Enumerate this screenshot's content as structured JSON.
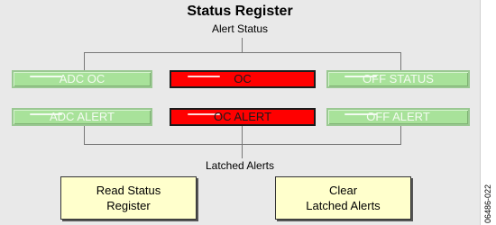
{
  "panel": {
    "title": "Status Register",
    "alert_status_label": "Alert Status",
    "latched_alerts_label": "Latched Alerts"
  },
  "indicators": {
    "adc_oc": {
      "label": "ADC OC",
      "state": "off"
    },
    "oc": {
      "label": "OC",
      "state": "on"
    },
    "off_status": {
      "label": "OFF STATUS",
      "state": "off"
    },
    "adc_alert": {
      "label": "ADC ALERT",
      "state": "off"
    },
    "oc_alert": {
      "label": "OC ALERT",
      "state": "on"
    },
    "off_alert": {
      "label": "OFF ALERT",
      "state": "off"
    }
  },
  "buttons": {
    "read_status": {
      "line1": "Read Status",
      "line2": "Register"
    },
    "clear_latched": {
      "line1": "Clear",
      "line2": "Latched Alerts"
    }
  },
  "figure_id": "06486-022",
  "colors": {
    "panel_bg": "#e9e9e9",
    "indicator_off": "#a8e29a",
    "indicator_on": "#ff0000",
    "button_bg": "#ffffcc"
  }
}
